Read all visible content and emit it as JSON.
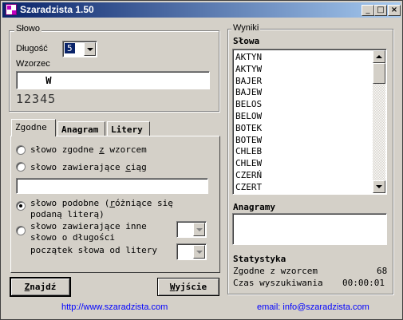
{
  "window": {
    "title": "Szaradzista 1.50",
    "minimize": "_",
    "maximize": "□",
    "close": "×"
  },
  "slowo": {
    "group_title": "Słowo",
    "length_label": "Długość",
    "length_value": "5",
    "pattern_label": "Wzorzec",
    "pattern_value": "    W",
    "position_digits": "12345"
  },
  "tabs": [
    {
      "label": "Zgodne"
    },
    {
      "label": "Anagram"
    },
    {
      "label": "Litery"
    }
  ],
  "zgodne": {
    "opt_pattern": "słowo zgodne z wzorcem",
    "opt_pattern_ul": "z",
    "opt_contains": "słowo zawierające ciąg",
    "opt_contains_ul": "c",
    "contains_value": "",
    "opt_similar_line1": "słowo podobne (różniące się",
    "opt_similar_line2": "podaną literą)",
    "opt_other_line1": "słowo zawierające inne",
    "opt_other_line2": "słowo o długości",
    "start_letter_label": "początek słowa od litery"
  },
  "buttons": {
    "find": "Znajdź",
    "exit": "Wyjście"
  },
  "links": {
    "website": "http://www.szaradzista.com",
    "email": "email: info@szaradzista.com"
  },
  "wyniki": {
    "group_title": "Wyniki",
    "words_label": "Słowa",
    "words": [
      "AKTYN",
      "AKTYW",
      "BAJER",
      "BAJEW",
      "BELOS",
      "BELOW",
      "BOTEK",
      "BOTEW",
      "CHLEB",
      "CHLEW",
      "CZERŃ",
      "CZERT"
    ],
    "anagrams_label": "Anagramy",
    "stats_label": "Statystyka",
    "stat_match_label": "Zgodne z wzorcem",
    "stat_match_value": "68",
    "stat_time_label": "Czas wyszukiwania",
    "stat_time_value": "00:00:01"
  }
}
